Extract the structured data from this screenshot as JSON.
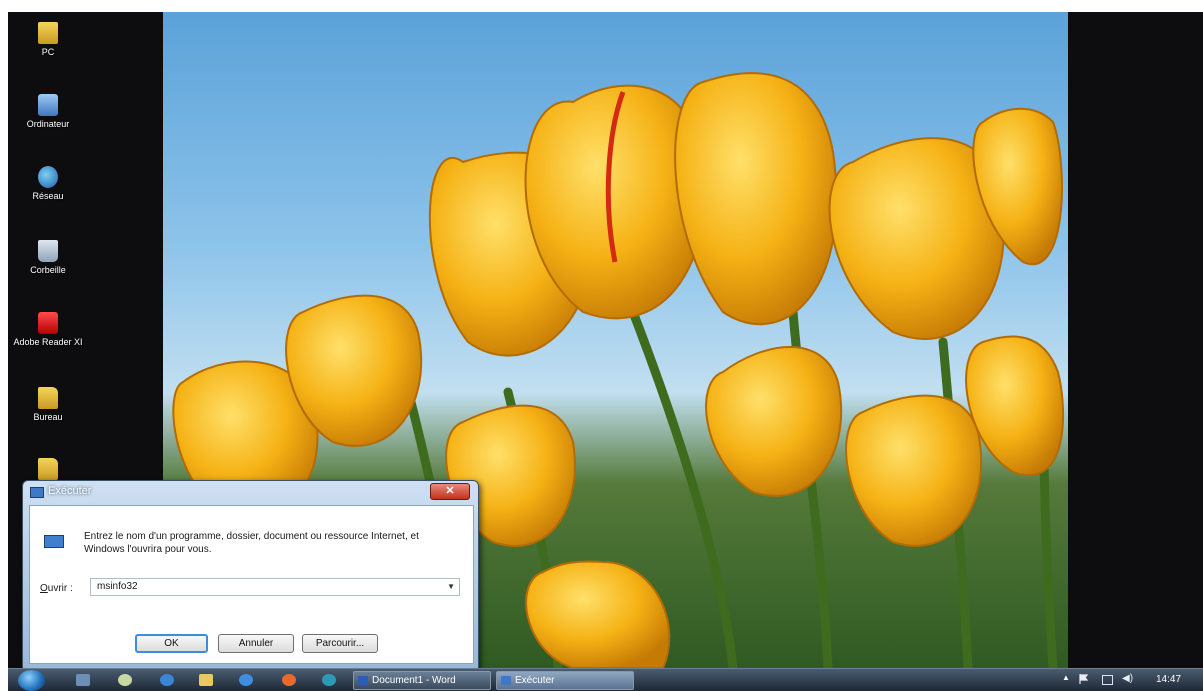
{
  "desktop": {
    "icons": [
      {
        "label": "PC",
        "icon": "folder-icon"
      },
      {
        "label": "Ordinateur",
        "icon": "computer-icon"
      },
      {
        "label": "Réseau",
        "icon": "network-icon"
      },
      {
        "label": "Corbeille",
        "icon": "recycle-bin-icon"
      },
      {
        "label": "Adobe Reader XI",
        "icon": "adobe-reader-icon"
      },
      {
        "label": "Bureau",
        "icon": "folder-icon"
      }
    ]
  },
  "run_dialog": {
    "title": "Exécuter",
    "description": "Entrez le nom d'un programme, dossier, document ou ressource Internet, et Windows l'ouvrira pour vous.",
    "open_label_accel": "O",
    "open_label_rest": "uvrir :",
    "open_value": "msinfo32",
    "ok_label": "OK",
    "cancel_label": "Annuler",
    "browse_label": "Parcourir..."
  },
  "taskbar": {
    "tasks": [
      {
        "label": "Document1 - Word",
        "icon": "word-icon"
      },
      {
        "label": "Exécuter",
        "icon": "run-icon"
      }
    ],
    "clock": "14:47"
  },
  "colors": {
    "taskbar": "#1c2633",
    "dialog_frame": "#9ab8d8",
    "ok_focus": "#3c8edc",
    "close_button": "#c0321d"
  }
}
